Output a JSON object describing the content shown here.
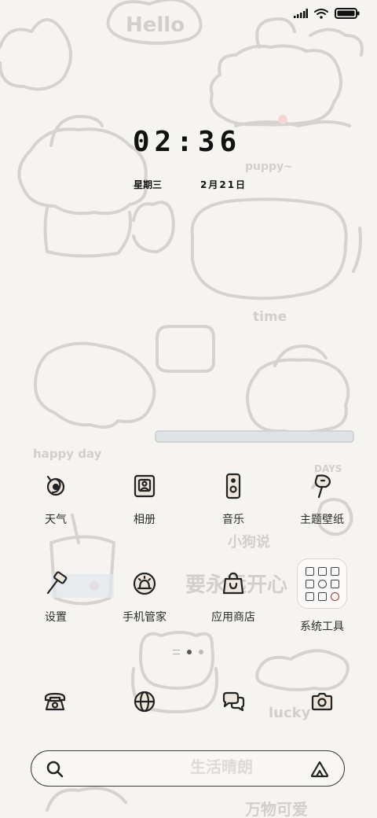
{
  "status_bar": {
    "icons": [
      "signal-icon",
      "wifi-icon",
      "battery-icon"
    ]
  },
  "clock": {
    "time": "02:36",
    "weekday": "星期三",
    "date": "2月21日"
  },
  "wallpaper_text": {
    "hello": "Hello",
    "puppy": "puppy~",
    "time": "time",
    "happy_day": "happy day",
    "days": "DAYS",
    "xiaogou": "小狗说",
    "yao": "要永远开心",
    "lucky": "lucky",
    "shenghuo": "生活晴朗",
    "wanwu": "万物可爱"
  },
  "apps_row1": [
    {
      "label": "天气",
      "icon": "weather-icon"
    },
    {
      "label": "相册",
      "icon": "gallery-icon"
    },
    {
      "label": "音乐",
      "icon": "music-icon"
    },
    {
      "label": "主题壁纸",
      "icon": "themes-icon"
    }
  ],
  "apps_row2": [
    {
      "label": "设置",
      "icon": "settings-icon"
    },
    {
      "label": "手机管家",
      "icon": "security-icon"
    },
    {
      "label": "应用商店",
      "icon": "app-store-icon"
    },
    {
      "label": "系统工具",
      "icon": "folder-icon"
    }
  ],
  "dock": [
    {
      "name": "phone",
      "icon": "phone-icon"
    },
    {
      "name": "browser",
      "icon": "globe-icon"
    },
    {
      "name": "messages",
      "icon": "chat-icon"
    },
    {
      "name": "camera",
      "icon": "camera-icon"
    }
  ],
  "pager": {
    "pages": 2,
    "current": 1
  },
  "search": {
    "left_icon": "search-icon",
    "right_icon": "assistant-icon"
  },
  "colors": {
    "background": "#f6f4f1",
    "sketch": "#d4d1cd",
    "text": "#2b2b2b"
  }
}
